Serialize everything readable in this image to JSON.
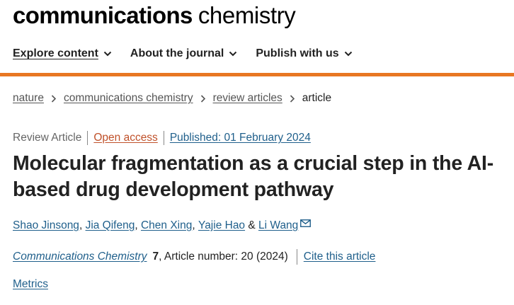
{
  "header": {
    "logo_bold": "communications",
    "logo_light": "chemistry"
  },
  "nav": {
    "items": [
      {
        "label": "Explore content"
      },
      {
        "label": "About the journal"
      },
      {
        "label": "Publish with us"
      }
    ]
  },
  "breadcrumb": [
    "nature",
    "communications chemistry",
    "review articles",
    "article"
  ],
  "article": {
    "type": "Review Article",
    "open_access": "Open access",
    "published": "Published: 01 February 2024",
    "title": "Molecular fragmentation as a crucial step in the AI-based drug development pathway",
    "authors": [
      "Shao Jinsong",
      "Jia Qifeng",
      "Chen Xing",
      "Yajie Hao",
      "Li Wang"
    ],
    "journal": "Communications Chemistry",
    "volume": "7",
    "article_number": ", Article number: 20 (2024)",
    "cite_label": "Cite this article",
    "metrics_label": "Metrics"
  },
  "colors": {
    "accent_bar": "#e87722",
    "link": "#1f5f8b",
    "open_access": "#c0512a"
  },
  "icons": [
    "chevron-down-icon",
    "chevron-right-icon",
    "envelope-icon"
  ]
}
